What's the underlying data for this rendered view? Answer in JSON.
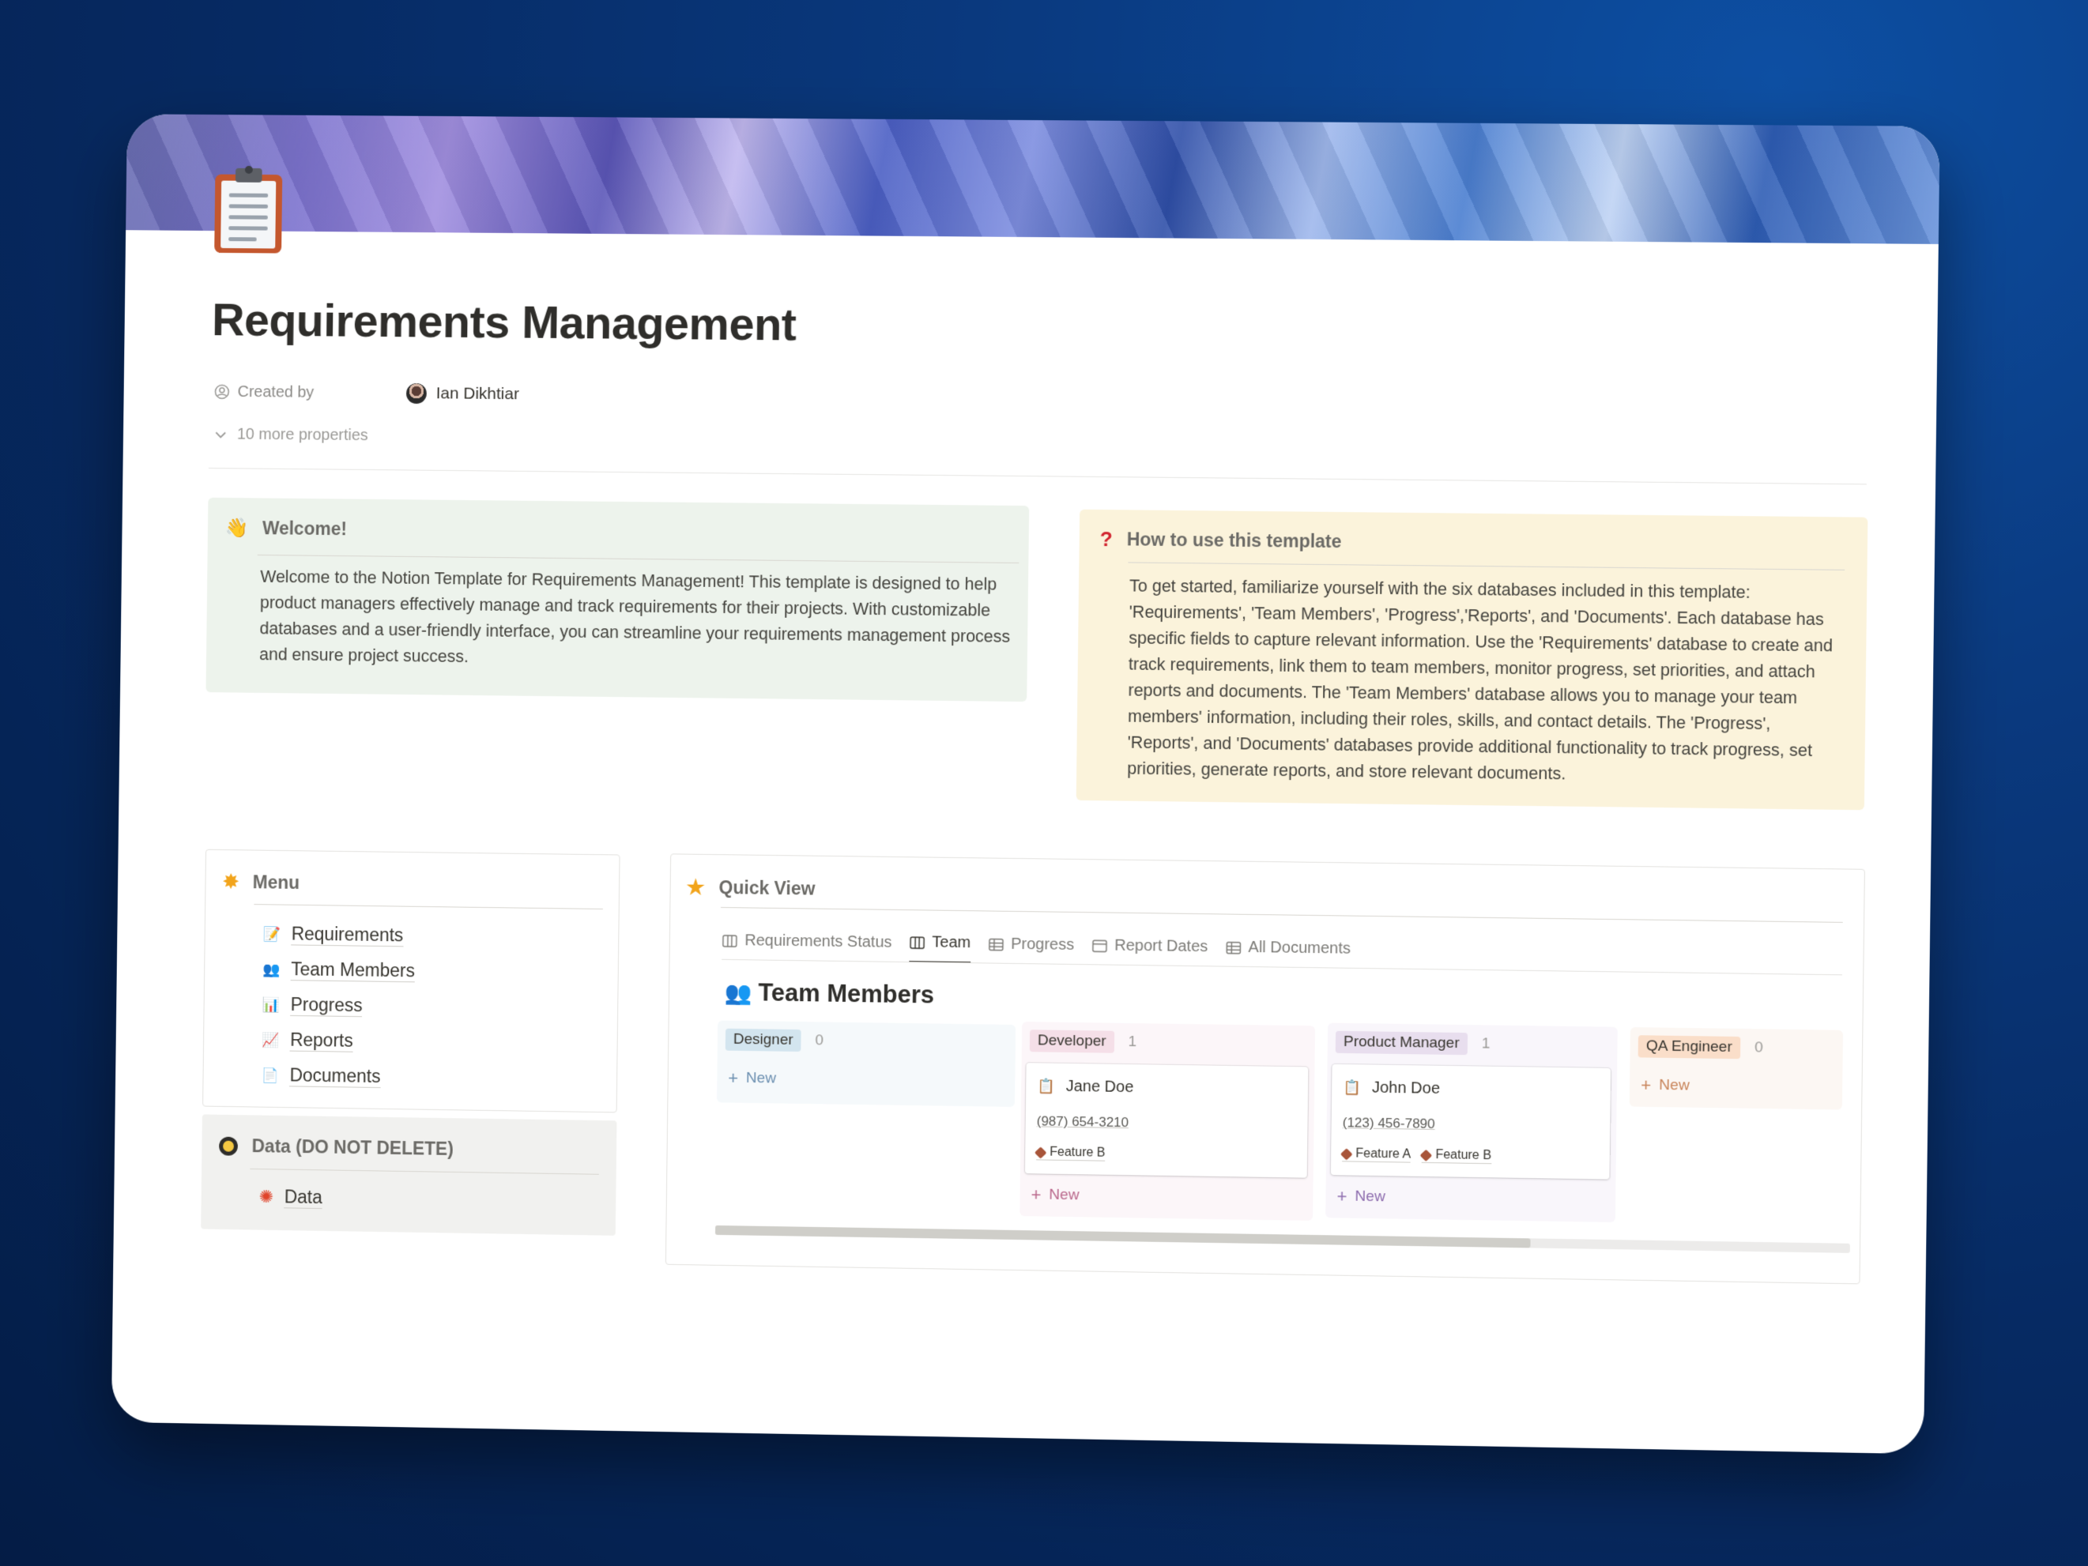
{
  "page": {
    "title": "Requirements Management",
    "created_by_label": "Created by",
    "created_by_value": "Ian Dikhtiar",
    "more_properties": "10 more properties"
  },
  "welcome": {
    "heading": "Welcome!",
    "body": "Welcome to the Notion Template for Requirements Management! This template is designed to help product managers effectively manage and track requirements for their projects. With customizable databases and a user-friendly interface, you can streamline your requirements management process and ensure project success."
  },
  "howto": {
    "heading": "How to use this template",
    "body": "To get started, familiarize yourself with the six databases included in this template: 'Requirements', 'Team Members', 'Progress','Reports', and 'Documents'. Each database has specific fields to capture relevant information. Use the 'Requirements' database to create and track requirements, link them to team members, monitor progress, set priorities, and attach reports and documents. The 'Team Members' database allows you to manage your team members' information, including their roles, skills, and contact details. The 'Progress', 'Reports', and 'Documents' databases provide additional functionality to track progress, set priorities, generate reports, and store relevant documents."
  },
  "menu": {
    "heading": "Menu",
    "items": [
      {
        "label": "Requirements",
        "icon": "memo-icon"
      },
      {
        "label": "Team Members",
        "icon": "people-icon"
      },
      {
        "label": "Progress",
        "icon": "bar-chart-icon"
      },
      {
        "label": "Reports",
        "icon": "chart-up-icon"
      },
      {
        "label": "Documents",
        "icon": "document-icon"
      }
    ]
  },
  "data_section": {
    "heading": "Data (DO NOT DELETE)",
    "item": "Data"
  },
  "quick_view": {
    "heading": "Quick View",
    "tabs": [
      {
        "label": "Requirements Status",
        "icon": "board-icon",
        "active": false
      },
      {
        "label": "Team",
        "icon": "board-icon",
        "active": true
      },
      {
        "label": "Progress",
        "icon": "table-icon",
        "active": false
      },
      {
        "label": "Report Dates",
        "icon": "calendar-icon",
        "active": false
      },
      {
        "label": "All Documents",
        "icon": "table-icon",
        "active": false
      }
    ],
    "board_title": "Team Members",
    "new_label": "New",
    "columns": [
      {
        "name": "Designer",
        "count": "0",
        "tag_color": "#d3e5ef",
        "bg_color": "#f5f9fb",
        "accent": "#6b8fb0"
      },
      {
        "name": "Developer",
        "count": "1",
        "tag_color": "#f5dfe8",
        "bg_color": "#fcf6f9",
        "accent": "#b9678b"
      },
      {
        "name": "Product Manager",
        "count": "1",
        "tag_color": "#e8deee",
        "bg_color": "#f9f6fb",
        "accent": "#8d6cae"
      },
      {
        "name": "QA Engineer",
        "count": "0",
        "tag_color": "#fadec9",
        "bg_color": "#fcf7f3",
        "accent": "#c8845a"
      }
    ],
    "cards": [
      {
        "name": "Jane Doe",
        "phone": "(987) 654-3210",
        "features": [
          "Feature B"
        ]
      },
      {
        "name": "John Doe",
        "phone": "(123) 456-7890",
        "features": [
          "Feature A",
          "Feature B"
        ]
      }
    ]
  }
}
